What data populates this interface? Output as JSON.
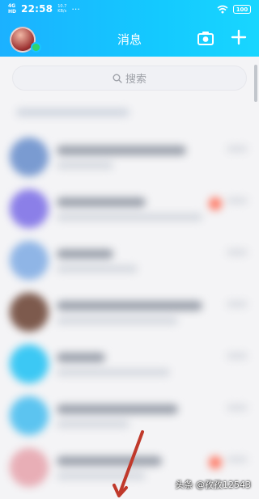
{
  "status_bar": {
    "network": "4G\nHD",
    "time": "22:58",
    "speed": "10.7\nKB/s",
    "more": "···",
    "battery": "100"
  },
  "header": {
    "title": "消息",
    "camera_icon": "camera-icon",
    "plus_icon": "plus-icon"
  },
  "search": {
    "placeholder": "搜索",
    "icon": "search-icon"
  },
  "colors": {
    "header_start": "#1bb1ff",
    "header_end": "#18d6ff",
    "background": "#f4f4f6",
    "annotation_arrow": "#c0392b"
  },
  "watermark": "头条 @孜孜12543"
}
